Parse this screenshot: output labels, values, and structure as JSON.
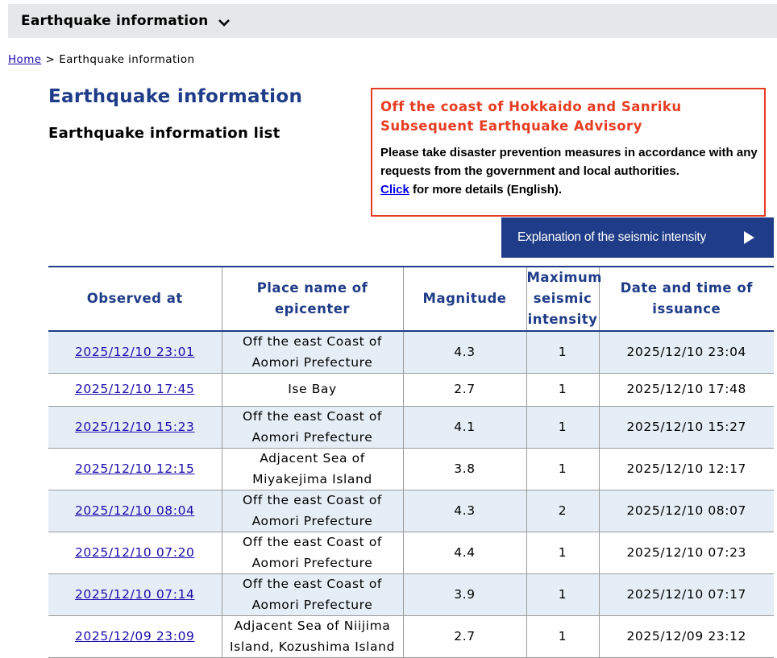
{
  "header": {
    "title": "Earthquake information"
  },
  "breadcrumb": {
    "home": "Home",
    "separator": ">",
    "current": "Earthquake information"
  },
  "main": {
    "title": "Earthquake information",
    "subtitle": "Earthquake information list"
  },
  "advisory": {
    "title_line1": "Off the coast of Hokkaido and Sanriku",
    "title_line2": "Subsequent Earthquake Advisory",
    "body": "Please take disaster prevention measures in accordance with any requests from the government and local authorities.",
    "link_text": "Click",
    "link_suffix": " for more details (English).",
    "accent_color": "#e83c22"
  },
  "explain_button": {
    "label": "Explanation of the seismic intensity"
  },
  "table": {
    "headers": {
      "observed": "Observed at",
      "place_l1": "Place name of",
      "place_l2": "epicenter",
      "magnitude": "Magnitude",
      "intensity_l1": "Maximum",
      "intensity_l2": "seismic",
      "intensity_l3": "intensity",
      "issued_l1": "Date and time of",
      "issued_l2": "issuance"
    },
    "rows": [
      {
        "observed": "2025/12/10 23:01",
        "place_l1": "Off the east Coast of",
        "place_l2": "Aomori Prefecture",
        "magnitude": "4.3",
        "intensity": "1",
        "issued": "2025/12/10 23:04"
      },
      {
        "observed": "2025/12/10 17:45",
        "place_l1": "Ise Bay",
        "place_l2": "",
        "magnitude": "2.7",
        "intensity": "1",
        "issued": "2025/12/10 17:48"
      },
      {
        "observed": "2025/12/10 15:23",
        "place_l1": "Off the east Coast of",
        "place_l2": "Aomori Prefecture",
        "magnitude": "4.1",
        "intensity": "1",
        "issued": "2025/12/10 15:27"
      },
      {
        "observed": "2025/12/10 12:15",
        "place_l1": "Adjacent Sea of",
        "place_l2": "Miyakejima Island",
        "magnitude": "3.8",
        "intensity": "1",
        "issued": "2025/12/10 12:17"
      },
      {
        "observed": "2025/12/10 08:04",
        "place_l1": "Off the east Coast of",
        "place_l2": "Aomori Prefecture",
        "magnitude": "4.3",
        "intensity": "2",
        "issued": "2025/12/10 08:07"
      },
      {
        "observed": "2025/12/10 07:20",
        "place_l1": "Off the east Coast of",
        "place_l2": "Aomori Prefecture",
        "magnitude": "4.4",
        "intensity": "1",
        "issued": "2025/12/10 07:23"
      },
      {
        "observed": "2025/12/10 07:14",
        "place_l1": "Off the east Coast of",
        "place_l2": "Aomori Prefecture",
        "magnitude": "3.9",
        "intensity": "1",
        "issued": "2025/12/10 07:17"
      },
      {
        "observed": "2025/12/09 23:09",
        "place_l1": "Adjacent Sea of Niijima",
        "place_l2": "Island, Kozushima Island",
        "magnitude": "2.7",
        "intensity": "1",
        "issued": "2025/12/09 23:12"
      }
    ]
  },
  "colors": {
    "brand_blue": "#1f3c88",
    "row_alt": "#e5eef6",
    "header_bar": "#e6e7e8"
  }
}
